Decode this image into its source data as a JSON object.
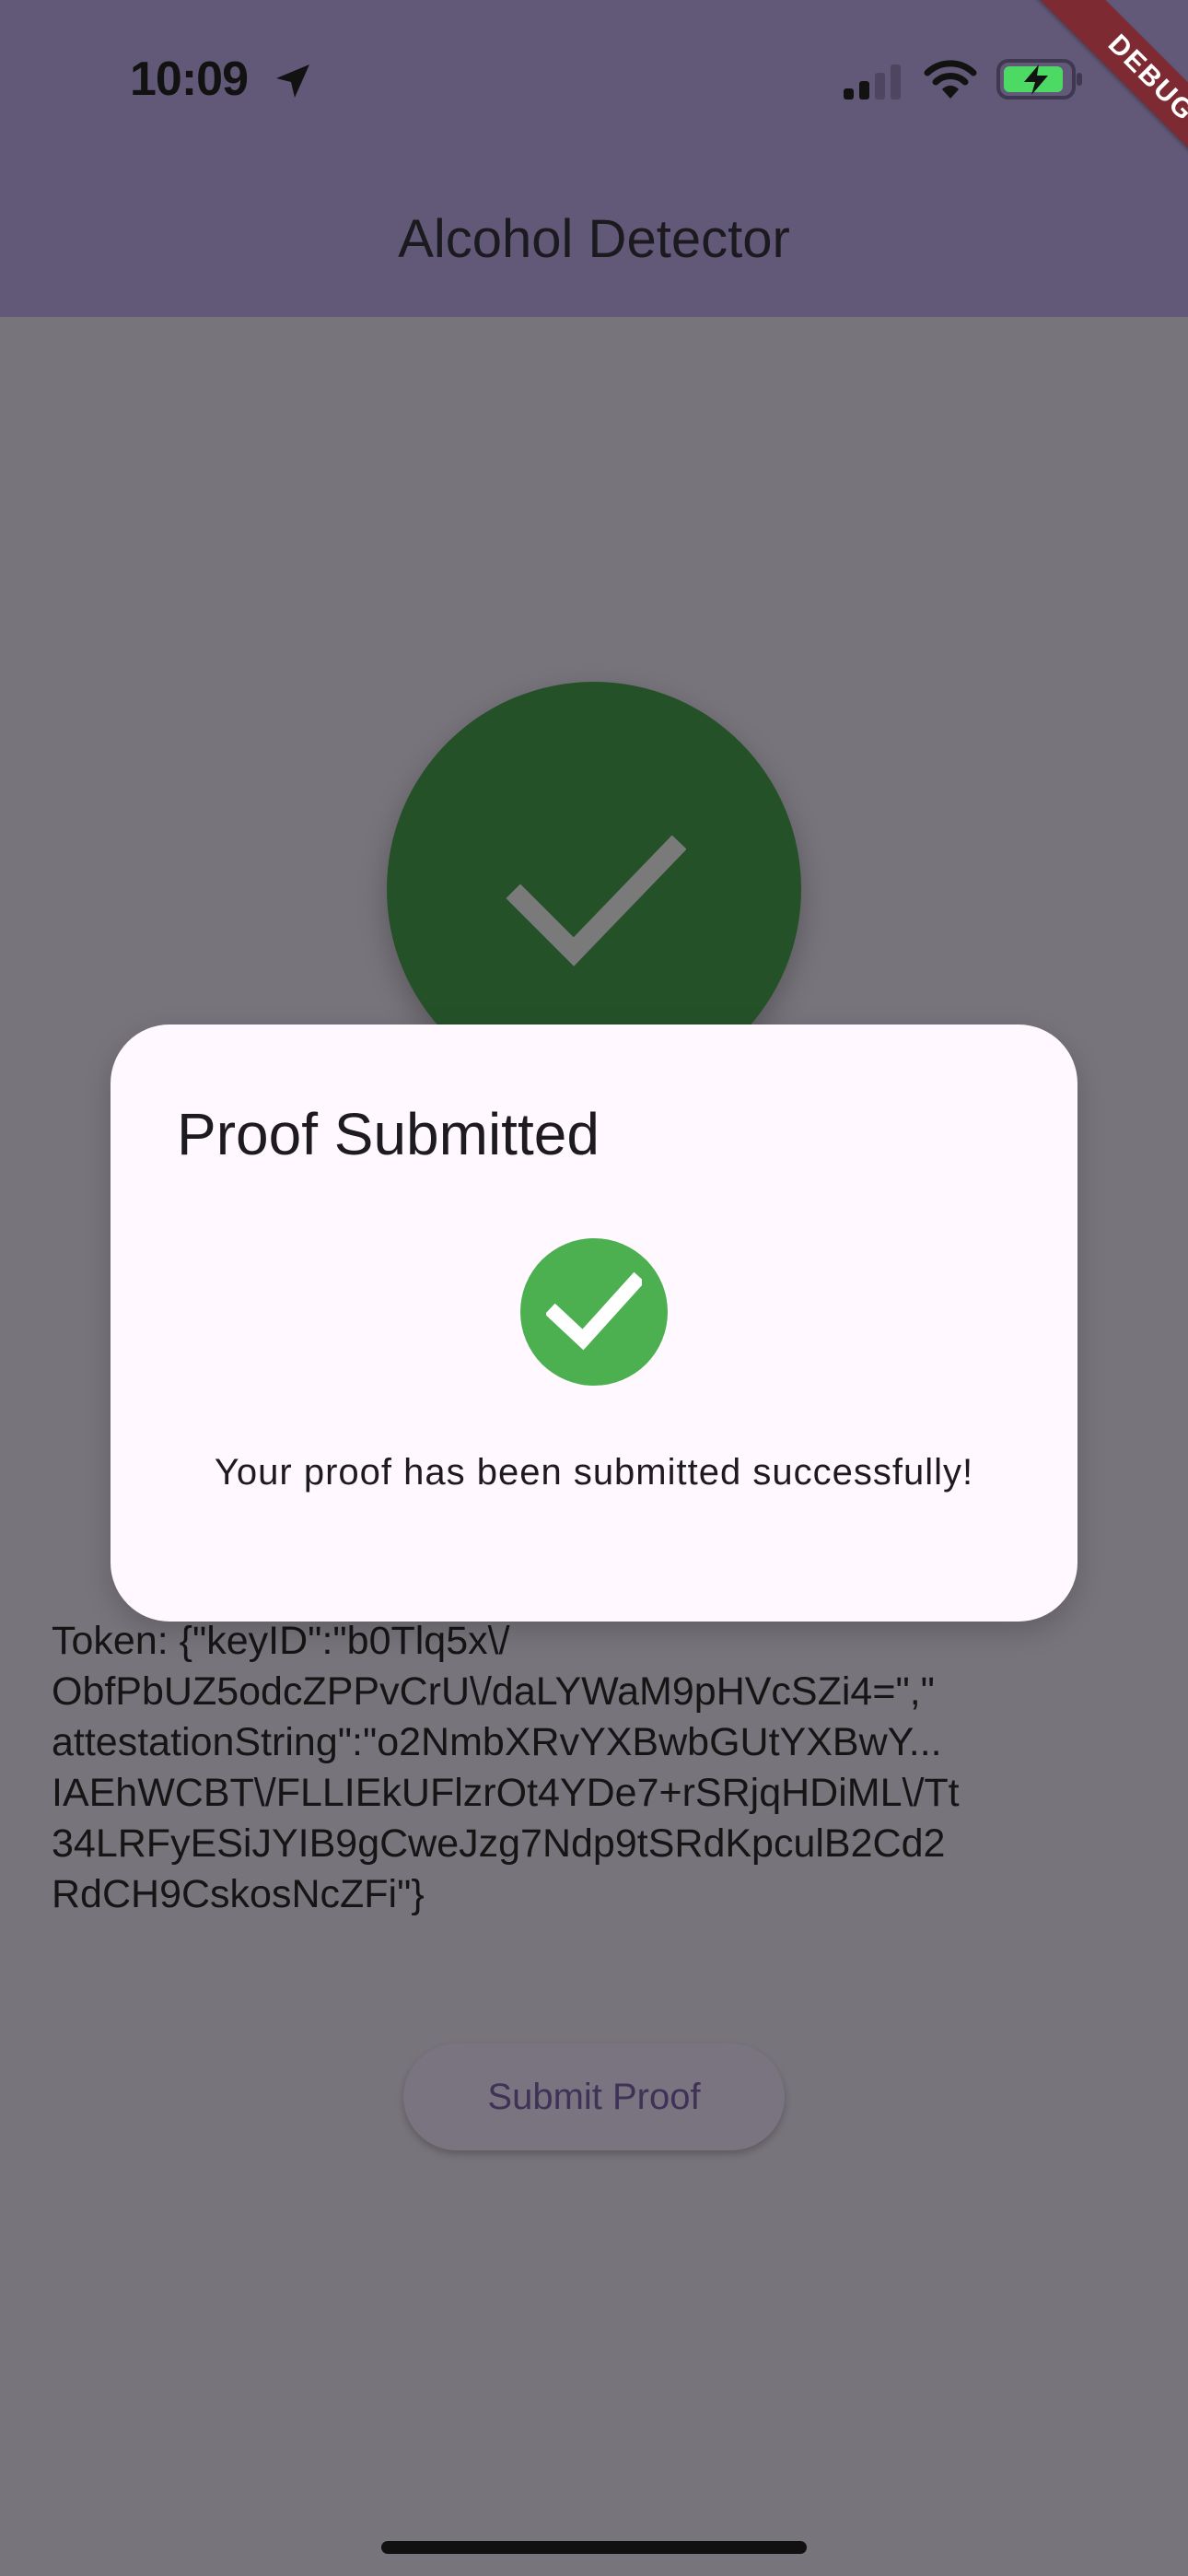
{
  "status_bar": {
    "time": "10:09",
    "icons": [
      "location-arrow-icon",
      "cellular-signal-icon",
      "wifi-icon",
      "battery-charging-icon"
    ]
  },
  "debug_banner": "DEBUG",
  "app_bar": {
    "title": "Alcohol Detector"
  },
  "main": {
    "result_icon": "check-icon",
    "token_text": "Token: {\"keyID\":\"b0Tlq5x\\/\nObfPbUZ5odcZPPvCrU\\/daLYWaM9pHVcSZi4=\",\"\nattestationString\":\"o2NmbXRvYXBwbGUtYXBwY...\nIAEhWCBT\\/FLLIEkUFlzrOt4YDe7+rSRjqHDiML\\/Tt\n34LRFyESiJYIB9gCweJzg7Ndp9tSRdKpculB2Cd2\nRdCH9CskosNcZFi\"}",
    "submit_label": "Submit Proof"
  },
  "dialog": {
    "title": "Proof Submitted",
    "icon": "check-circle-icon",
    "message": "Your proof has been submitted successfully!"
  },
  "colors": {
    "app_bar": "#625979",
    "scrim_background": "#77747b",
    "big_check_circle": "#255129",
    "dialog_background": "#fff8fe",
    "success_green": "#4caf50",
    "debug_banner": "#7d2a33"
  }
}
